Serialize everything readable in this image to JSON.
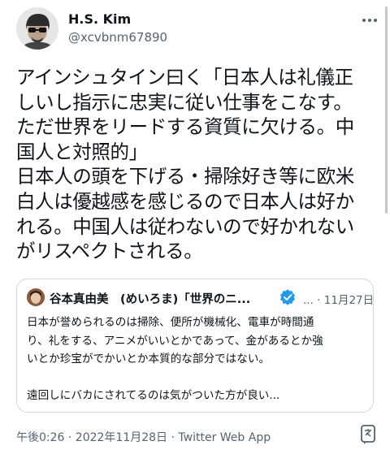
{
  "author": {
    "name": "H.S. Kim",
    "handle": "@xcvbnm67890"
  },
  "tweet": {
    "lines": [
      "アインシュタイン曰く「日本人は礼儀正",
      "しいし指示に忠実に従い仕事をこなす。",
      "ただ世界をリードする資質に欠ける。中",
      "国人と対照的」",
      "日本人の頭を下げる・掃除好き等に欧米",
      "白人は優越感を感じるので日本人は好か",
      "れる。中国人は従わないので好かれない",
      "がリスペクトされる。"
    ]
  },
  "quoted_tweet": {
    "author": "谷本真由美　(めいろま)「世界のニ...",
    "dots": "...",
    "date": "11月27日",
    "body_lines": [
      "日本が誉められるのは掃除、便所が機械化、電車が時間通",
      "り、礼をする、アニメがいいとかであって、金があるとか強",
      "いとか珍宝がでかいとか本質的な部分ではない。",
      "",
      "遠回しにバカにされてるのは気がついた方が良い..."
    ]
  },
  "timestamp": "午後0:26 · 2022年11月28日 · Twitter Web App",
  "colors": {
    "text": "#0f1419",
    "secondary": "#536471",
    "border": "#cfd9de",
    "verified": "#1d9bf0"
  },
  "icons": {
    "more": "more-icon",
    "verified": "verified-badge-icon",
    "translate": "translate-icon"
  }
}
